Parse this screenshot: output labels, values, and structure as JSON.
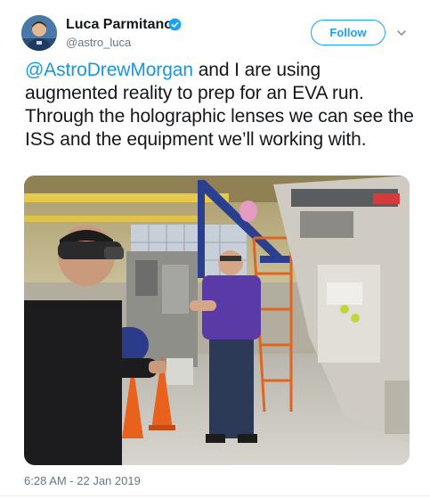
{
  "author": {
    "name": "Luca Parmitano",
    "handle": "@astro_luca",
    "verified": true,
    "avatar_icon": "astronaut-avatar"
  },
  "actions": {
    "follow_label": "Follow",
    "menu_icon": "chevron-down-icon"
  },
  "tweet": {
    "mention": "@AstroDrewMorgan",
    "text_after_mention": " and I are using augmented reality to prep for an EVA run. Through the holographic lenses we can see the ISS and the equipment we’ll working with.",
    "timestamp": "6:28 AM - 22 Jan 2019"
  },
  "colors": {
    "brand_blue": "#1da1f2",
    "mention_blue": "#1b95e0",
    "secondary_text": "#657786"
  }
}
